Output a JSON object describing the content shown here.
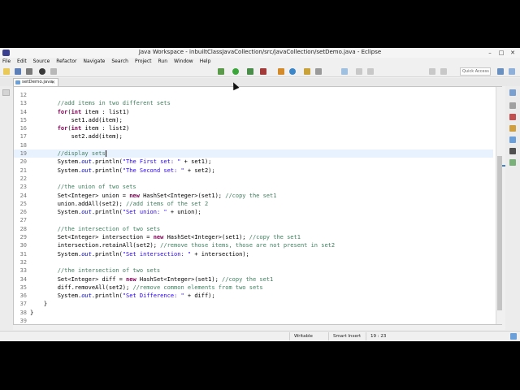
{
  "window": {
    "title": "Java Workspace - inbuiltClassJavaCollection/src/javaCollection/setDemo.java - Eclipse",
    "controls": [
      "–",
      "□",
      "✕"
    ]
  },
  "menu": [
    "File",
    "Edit",
    "Source",
    "Refactor",
    "Navigate",
    "Search",
    "Project",
    "Run",
    "Window",
    "Help"
  ],
  "toolbar": {
    "quick_access_placeholder": "Quick Access"
  },
  "tabs": [
    {
      "label": "setDemo.java",
      "close": "✕",
      "active": true
    }
  ],
  "editor": {
    "current_line": 19,
    "lines": [
      {
        "n": "12",
        "segments": []
      },
      {
        "n": "13",
        "segments": [
          {
            "t": "        "
          },
          {
            "t": "//add items in two different sets",
            "c": "cm"
          }
        ]
      },
      {
        "n": "14",
        "segments": [
          {
            "t": "        "
          },
          {
            "t": "for",
            "c": "kw"
          },
          {
            "t": "("
          },
          {
            "t": "int",
            "c": "kw"
          },
          {
            "t": " item : list1)"
          }
        ]
      },
      {
        "n": "15",
        "segments": [
          {
            "t": "            set1.add(item);"
          }
        ]
      },
      {
        "n": "16",
        "segments": [
          {
            "t": "        "
          },
          {
            "t": "for",
            "c": "kw"
          },
          {
            "t": "("
          },
          {
            "t": "int",
            "c": "kw"
          },
          {
            "t": " item : list2)"
          }
        ]
      },
      {
        "n": "17",
        "segments": [
          {
            "t": "            set2.add(item);"
          }
        ]
      },
      {
        "n": "18",
        "segments": []
      },
      {
        "n": "19",
        "segments": [
          {
            "t": "        "
          },
          {
            "t": "//display sets",
            "c": "cm"
          }
        ]
      },
      {
        "n": "20",
        "segments": [
          {
            "t": "        System."
          },
          {
            "t": "out",
            "c": "fd"
          },
          {
            "t": ".println("
          },
          {
            "t": "\"The First set: \"",
            "c": "st"
          },
          {
            "t": " + set1);"
          }
        ]
      },
      {
        "n": "21",
        "segments": [
          {
            "t": "        System."
          },
          {
            "t": "out",
            "c": "fd"
          },
          {
            "t": ".println("
          },
          {
            "t": "\"The Second set: \"",
            "c": "st"
          },
          {
            "t": " + set2);"
          }
        ]
      },
      {
        "n": "22",
        "segments": []
      },
      {
        "n": "23",
        "segments": [
          {
            "t": "        "
          },
          {
            "t": "//the union of two sets",
            "c": "cm"
          }
        ]
      },
      {
        "n": "24",
        "segments": [
          {
            "t": "        Set<Integer> union = "
          },
          {
            "t": "new",
            "c": "kw"
          },
          {
            "t": " HashSet<Integer>(set1); "
          },
          {
            "t": "//copy the set1",
            "c": "cm"
          }
        ]
      },
      {
        "n": "25",
        "segments": [
          {
            "t": "        union.addAll(set2); "
          },
          {
            "t": "//add items of the set 2",
            "c": "cm"
          }
        ]
      },
      {
        "n": "26",
        "segments": [
          {
            "t": "        System."
          },
          {
            "t": "out",
            "c": "fd"
          },
          {
            "t": ".println("
          },
          {
            "t": "\"Set union: \"",
            "c": "st"
          },
          {
            "t": " + union);"
          }
        ]
      },
      {
        "n": "27",
        "segments": []
      },
      {
        "n": "28",
        "segments": [
          {
            "t": "        "
          },
          {
            "t": "//the intersection of two sets",
            "c": "cm"
          }
        ]
      },
      {
        "n": "29",
        "segments": [
          {
            "t": "        Set<Integer> intersection = "
          },
          {
            "t": "new",
            "c": "kw"
          },
          {
            "t": " HashSet<Integer>(set1); "
          },
          {
            "t": "//copy the set1",
            "c": "cm"
          }
        ]
      },
      {
        "n": "30",
        "segments": [
          {
            "t": "        intersection.retainAll(set2); "
          },
          {
            "t": "//remove those items, those are not present in set2",
            "c": "cm"
          }
        ]
      },
      {
        "n": "31",
        "segments": [
          {
            "t": "        System."
          },
          {
            "t": "out",
            "c": "fd"
          },
          {
            "t": ".println("
          },
          {
            "t": "\"Set intersection: \"",
            "c": "st"
          },
          {
            "t": " + intersection);"
          }
        ]
      },
      {
        "n": "32",
        "segments": []
      },
      {
        "n": "33",
        "segments": [
          {
            "t": "        "
          },
          {
            "t": "//the intersection of two sets",
            "c": "cm"
          }
        ]
      },
      {
        "n": "34",
        "segments": [
          {
            "t": "        Set<Integer> diff = "
          },
          {
            "t": "new",
            "c": "kw"
          },
          {
            "t": " HashSet<Integer>(set1); "
          },
          {
            "t": "//copy the set1",
            "c": "cm"
          }
        ]
      },
      {
        "n": "35",
        "segments": [
          {
            "t": "        diff.removeAll(set2); "
          },
          {
            "t": "//remove common elements from two sets",
            "c": "cm"
          }
        ]
      },
      {
        "n": "36",
        "segments": [
          {
            "t": "        System."
          },
          {
            "t": "out",
            "c": "fd"
          },
          {
            "t": ".println("
          },
          {
            "t": "\"Set Difference: \"",
            "c": "st"
          },
          {
            "t": " + diff);"
          }
        ]
      },
      {
        "n": "37",
        "segments": [
          {
            "t": "    }"
          }
        ]
      },
      {
        "n": "38",
        "segments": [
          {
            "t": "}"
          }
        ]
      },
      {
        "n": "39",
        "segments": []
      }
    ]
  },
  "status": {
    "writable": "Writable",
    "insert_mode": "Smart Insert",
    "position": "19 : 23"
  },
  "colors": {
    "keyword": "#7f0055",
    "comment": "#3f7f5f",
    "string": "#2a00ff",
    "field": "#0000c0",
    "current_line": "#e8f2fe"
  },
  "icons": {
    "toolbar": [
      "new-file-icon",
      "save-icon",
      "print-icon",
      "debug-icon",
      "run-icon",
      "external-tools-icon",
      "new-java-project-icon",
      "new-package-icon",
      "new-class-icon",
      "open-type-icon",
      "search-icon",
      "prev-annotation-icon",
      "next-annotation-icon",
      "back-icon",
      "forward-icon"
    ],
    "right_strip": [
      "outline-icon",
      "task-list-icon",
      "problems-icon",
      "javadoc-icon",
      "declaration-icon",
      "console-icon",
      "search-results-icon"
    ]
  }
}
